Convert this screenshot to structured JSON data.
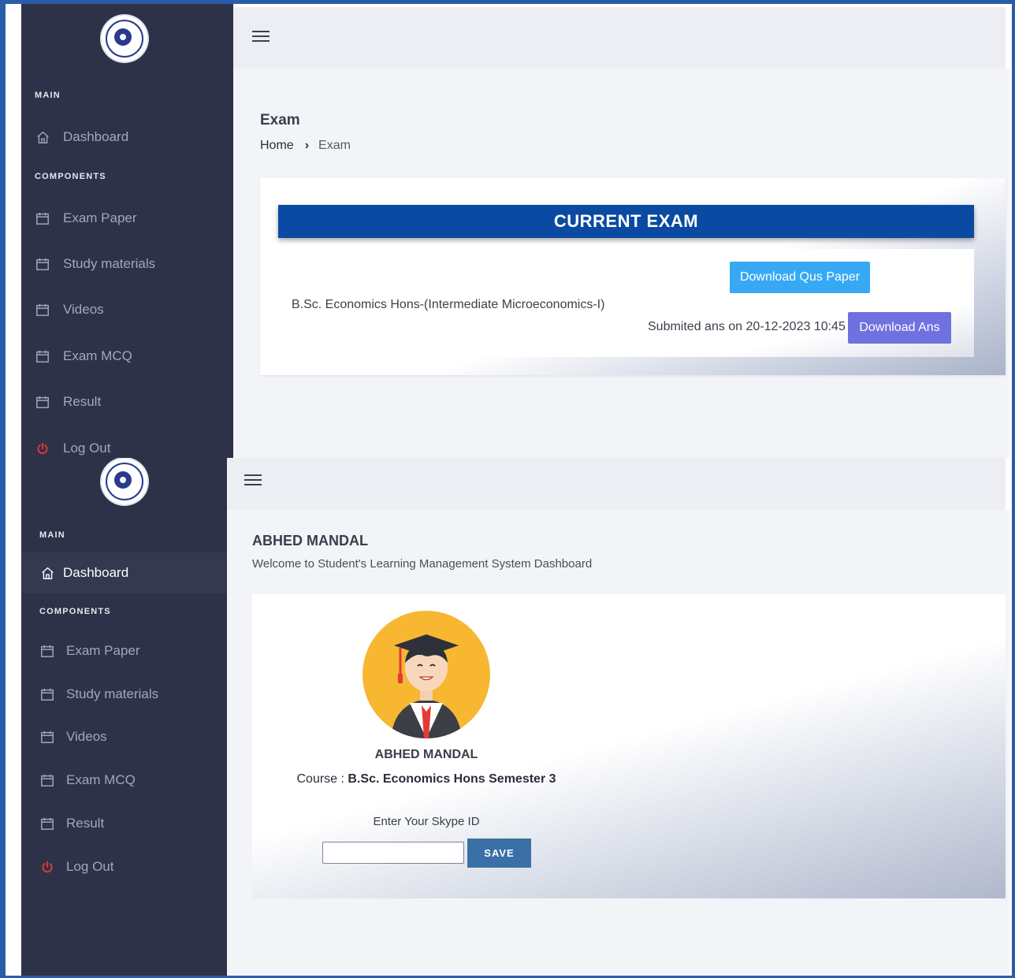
{
  "screen1": {
    "sidebar": {
      "section_main": "MAIN",
      "section_components": "COMPONENTS",
      "items": [
        {
          "label": "Dashboard",
          "icon": "home-icon"
        },
        {
          "label": "Exam Paper",
          "icon": "calendar-icon"
        },
        {
          "label": "Study materials",
          "icon": "calendar-icon"
        },
        {
          "label": "Videos",
          "icon": "calendar-icon"
        },
        {
          "label": "Exam MCQ",
          "icon": "calendar-icon"
        },
        {
          "label": "Result",
          "icon": "calendar-icon"
        },
        {
          "label": "Log Out",
          "icon": "power-icon"
        }
      ]
    },
    "page_title": "Exam",
    "breadcrumb": {
      "home": "Home",
      "current": "Exam"
    },
    "exam_card": {
      "header": "CURRENT EXAM",
      "exam_name": "B.Sc. Economics Hons-(Intermediate Microeconomics-I)",
      "download_qus_label": "Download Qus Paper",
      "submitted_text": "Submited ans on 20-12-2023 10:45",
      "download_ans_label": "Download Ans"
    }
  },
  "screen2": {
    "sidebar": {
      "section_main": "MAIN",
      "section_components": "COMPONENTS",
      "items": [
        {
          "label": "Dashboard",
          "icon": "home-icon",
          "active": true
        },
        {
          "label": "Exam Paper",
          "icon": "calendar-icon"
        },
        {
          "label": "Study materials",
          "icon": "calendar-icon"
        },
        {
          "label": "Videos",
          "icon": "calendar-icon"
        },
        {
          "label": "Exam MCQ",
          "icon": "calendar-icon"
        },
        {
          "label": "Result",
          "icon": "calendar-icon"
        },
        {
          "label": "Log Out",
          "icon": "power-icon"
        }
      ]
    },
    "page_title": "ABHED MANDAL",
    "welcome": "Welcome to Student's Learning Management System Dashboard",
    "profile": {
      "name": "ABHED MANDAL",
      "course_label": "Course : ",
      "course_value": "B.Sc. Economics Hons Semester 3",
      "skype_label": "Enter Your Skype ID",
      "skype_value": "",
      "save_label": "SAVE"
    }
  },
  "colors": {
    "sidebar_bg": "#2e3248",
    "exam_header_bg": "#0b4aa2",
    "download_qus_bg": "#37a9f4",
    "download_ans_bg": "#6f71e0",
    "save_bg": "#3a70a6",
    "logout_icon": "#e53935",
    "avatar_bg": "#f7b731"
  }
}
